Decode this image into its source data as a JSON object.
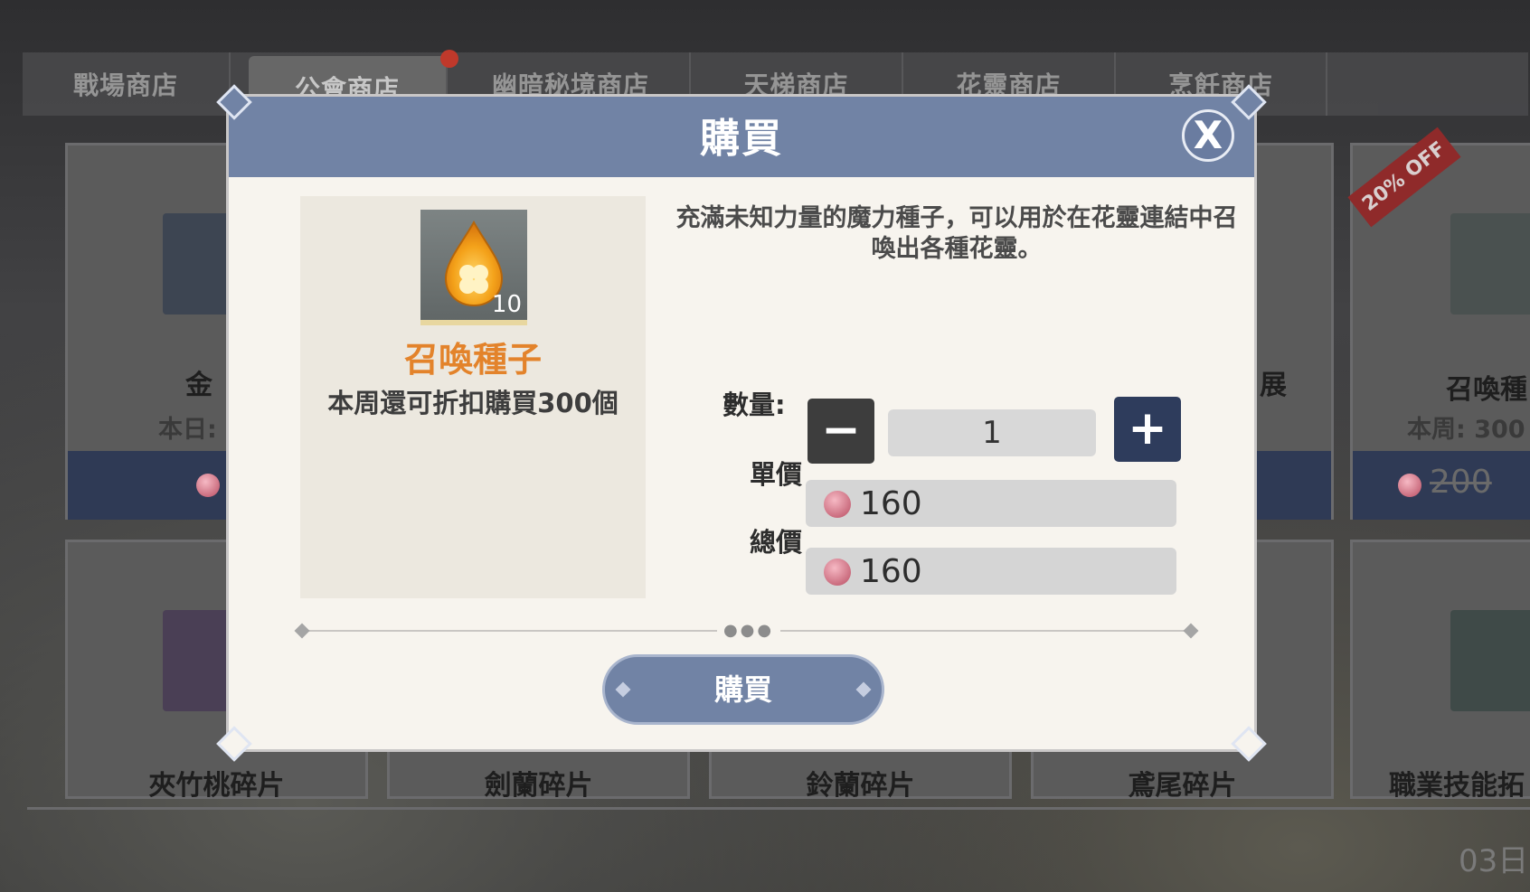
{
  "tabs": [
    {
      "label": "戰場商店",
      "active": false
    },
    {
      "label": "公會商店",
      "active": true
    },
    {
      "label": "幽暗秘境商店",
      "active": false
    },
    {
      "label": "天梯商店",
      "active": false
    },
    {
      "label": "花靈商店",
      "active": false
    },
    {
      "label": "烹飪商店",
      "active": false
    }
  ],
  "shop_cards": {
    "top_left": {
      "title": "金",
      "sub": "本日:"
    },
    "top_right_partial": {
      "title": "展"
    },
    "top_far_right": {
      "title": "召喚種",
      "sub": "本周: 300",
      "old_price": "200",
      "badge": "20% OFF"
    },
    "bottom": [
      {
        "title": "夾竹桃碎片"
      },
      {
        "title": "劍蘭碎片"
      },
      {
        "title": "鈴蘭碎片"
      },
      {
        "title": "鳶尾碎片"
      },
      {
        "title": "職業技能拓"
      }
    ]
  },
  "footer": {
    "code": "03日"
  },
  "dialog": {
    "title": "購買",
    "close_label": "X",
    "item": {
      "name": "召喚種子",
      "count": "10",
      "limit_text": "本周還可折扣購買300個"
    },
    "description": "充滿未知力量的魔力種子，可以用於在花靈連結中召喚出各種花靈。",
    "quantity": {
      "label": "數量:",
      "value": "1",
      "minus": "−",
      "plus": "+"
    },
    "unit_price": {
      "label": "單價",
      "value": "160"
    },
    "total_price": {
      "label": "總價",
      "value": "160"
    },
    "buy_button": "購買"
  },
  "colors": {
    "header_blue": "#7183a5",
    "item_name_orange": "#e3832b",
    "currency_gem": "#d0637a"
  }
}
